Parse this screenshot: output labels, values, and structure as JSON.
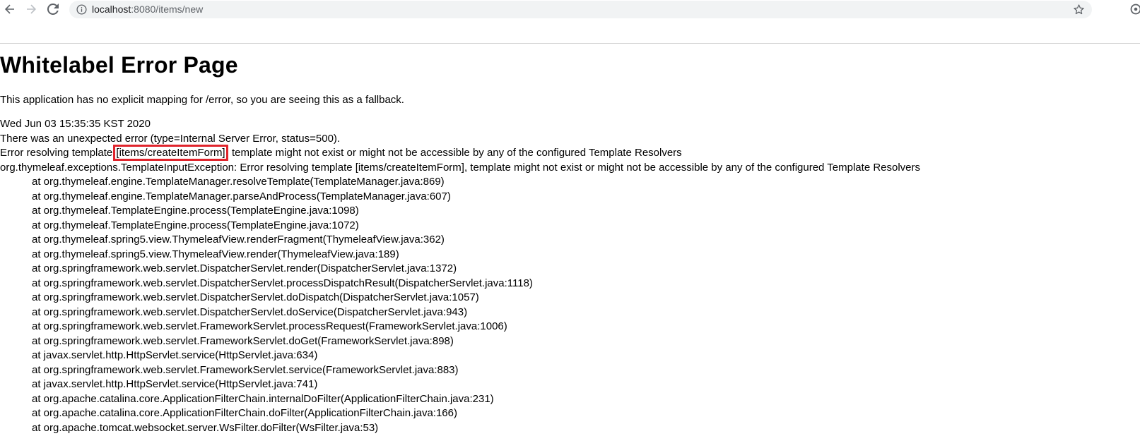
{
  "browser": {
    "url_host": "localhost",
    "url_path": ":8080/items/new",
    "icons": {
      "back": "arrow-left-icon",
      "forward": "arrow-right-icon",
      "reload": "reload-icon",
      "info": "info-circle-icon",
      "bookmark": "star-icon"
    }
  },
  "page": {
    "title": "Whitelabel Error Page",
    "fallback_text": "This application has no explicit mapping for /error, so you are seeing this as a fallback.",
    "timestamp": "Wed Jun 03 15:35:35 KST 2020",
    "error_summary": "There was an unexpected error (type=Internal Server Error, status=500).",
    "resolve_error": {
      "prefix": "Error resolving template ",
      "highlight": "[items/createItemForm]",
      "suffix": ", template might not exist or might not be accessible by any of the configured Template Resolvers"
    },
    "exception": "org.thymeleaf.exceptions.TemplateInputException: Error resolving template [items/createItemForm], template might not exist or might not be accessible by any of the configured Template Resolvers",
    "stack_trace": [
      "at org.thymeleaf.engine.TemplateManager.resolveTemplate(TemplateManager.java:869)",
      "at org.thymeleaf.engine.TemplateManager.parseAndProcess(TemplateManager.java:607)",
      "at org.thymeleaf.TemplateEngine.process(TemplateEngine.java:1098)",
      "at org.thymeleaf.TemplateEngine.process(TemplateEngine.java:1072)",
      "at org.thymeleaf.spring5.view.ThymeleafView.renderFragment(ThymeleafView.java:362)",
      "at org.thymeleaf.spring5.view.ThymeleafView.render(ThymeleafView.java:189)",
      "at org.springframework.web.servlet.DispatcherServlet.render(DispatcherServlet.java:1372)",
      "at org.springframework.web.servlet.DispatcherServlet.processDispatchResult(DispatcherServlet.java:1118)",
      "at org.springframework.web.servlet.DispatcherServlet.doDispatch(DispatcherServlet.java:1057)",
      "at org.springframework.web.servlet.DispatcherServlet.doService(DispatcherServlet.java:943)",
      "at org.springframework.web.servlet.FrameworkServlet.processRequest(FrameworkServlet.java:1006)",
      "at org.springframework.web.servlet.FrameworkServlet.doGet(FrameworkServlet.java:898)",
      "at javax.servlet.http.HttpServlet.service(HttpServlet.java:634)",
      "at org.springframework.web.servlet.FrameworkServlet.service(FrameworkServlet.java:883)",
      "at javax.servlet.http.HttpServlet.service(HttpServlet.java:741)",
      "at org.apache.catalina.core.ApplicationFilterChain.internalDoFilter(ApplicationFilterChain.java:231)",
      "at org.apache.catalina.core.ApplicationFilterChain.doFilter(ApplicationFilterChain.java:166)",
      "at org.apache.tomcat.websocket.server.WsFilter.doFilter(WsFilter.java:53)"
    ]
  },
  "colors": {
    "highlight_box": "#e0242c",
    "omnibox_bg": "#f1f3f4",
    "icon": "#5f6368"
  }
}
